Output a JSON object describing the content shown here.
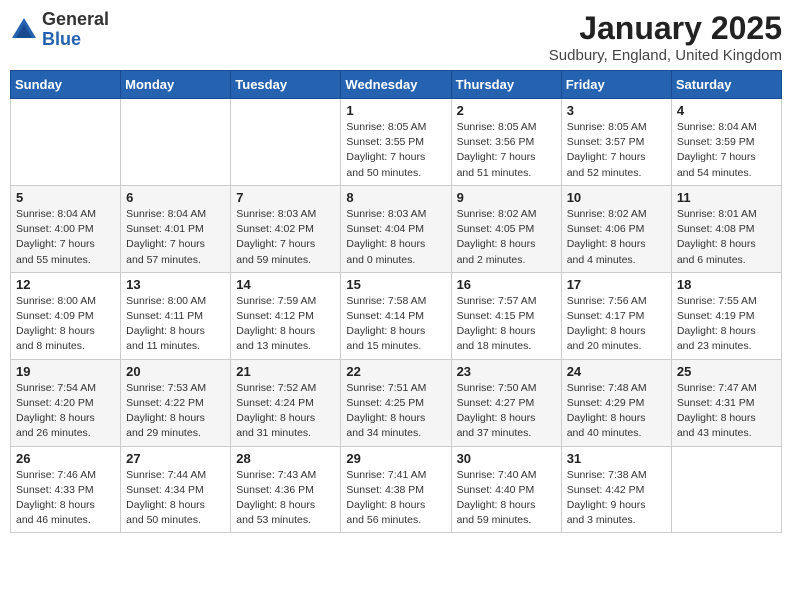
{
  "header": {
    "logo_general": "General",
    "logo_blue": "Blue",
    "month_title": "January 2025",
    "subtitle": "Sudbury, England, United Kingdom"
  },
  "days_of_week": [
    "Sunday",
    "Monday",
    "Tuesday",
    "Wednesday",
    "Thursday",
    "Friday",
    "Saturday"
  ],
  "weeks": [
    [
      {
        "day": "",
        "info": ""
      },
      {
        "day": "",
        "info": ""
      },
      {
        "day": "",
        "info": ""
      },
      {
        "day": "1",
        "info": "Sunrise: 8:05 AM\nSunset: 3:55 PM\nDaylight: 7 hours\nand 50 minutes."
      },
      {
        "day": "2",
        "info": "Sunrise: 8:05 AM\nSunset: 3:56 PM\nDaylight: 7 hours\nand 51 minutes."
      },
      {
        "day": "3",
        "info": "Sunrise: 8:05 AM\nSunset: 3:57 PM\nDaylight: 7 hours\nand 52 minutes."
      },
      {
        "day": "4",
        "info": "Sunrise: 8:04 AM\nSunset: 3:59 PM\nDaylight: 7 hours\nand 54 minutes."
      }
    ],
    [
      {
        "day": "5",
        "info": "Sunrise: 8:04 AM\nSunset: 4:00 PM\nDaylight: 7 hours\nand 55 minutes."
      },
      {
        "day": "6",
        "info": "Sunrise: 8:04 AM\nSunset: 4:01 PM\nDaylight: 7 hours\nand 57 minutes."
      },
      {
        "day": "7",
        "info": "Sunrise: 8:03 AM\nSunset: 4:02 PM\nDaylight: 7 hours\nand 59 minutes."
      },
      {
        "day": "8",
        "info": "Sunrise: 8:03 AM\nSunset: 4:04 PM\nDaylight: 8 hours\nand 0 minutes."
      },
      {
        "day": "9",
        "info": "Sunrise: 8:02 AM\nSunset: 4:05 PM\nDaylight: 8 hours\nand 2 minutes."
      },
      {
        "day": "10",
        "info": "Sunrise: 8:02 AM\nSunset: 4:06 PM\nDaylight: 8 hours\nand 4 minutes."
      },
      {
        "day": "11",
        "info": "Sunrise: 8:01 AM\nSunset: 4:08 PM\nDaylight: 8 hours\nand 6 minutes."
      }
    ],
    [
      {
        "day": "12",
        "info": "Sunrise: 8:00 AM\nSunset: 4:09 PM\nDaylight: 8 hours\nand 8 minutes."
      },
      {
        "day": "13",
        "info": "Sunrise: 8:00 AM\nSunset: 4:11 PM\nDaylight: 8 hours\nand 11 minutes."
      },
      {
        "day": "14",
        "info": "Sunrise: 7:59 AM\nSunset: 4:12 PM\nDaylight: 8 hours\nand 13 minutes."
      },
      {
        "day": "15",
        "info": "Sunrise: 7:58 AM\nSunset: 4:14 PM\nDaylight: 8 hours\nand 15 minutes."
      },
      {
        "day": "16",
        "info": "Sunrise: 7:57 AM\nSunset: 4:15 PM\nDaylight: 8 hours\nand 18 minutes."
      },
      {
        "day": "17",
        "info": "Sunrise: 7:56 AM\nSunset: 4:17 PM\nDaylight: 8 hours\nand 20 minutes."
      },
      {
        "day": "18",
        "info": "Sunrise: 7:55 AM\nSunset: 4:19 PM\nDaylight: 8 hours\nand 23 minutes."
      }
    ],
    [
      {
        "day": "19",
        "info": "Sunrise: 7:54 AM\nSunset: 4:20 PM\nDaylight: 8 hours\nand 26 minutes."
      },
      {
        "day": "20",
        "info": "Sunrise: 7:53 AM\nSunset: 4:22 PM\nDaylight: 8 hours\nand 29 minutes."
      },
      {
        "day": "21",
        "info": "Sunrise: 7:52 AM\nSunset: 4:24 PM\nDaylight: 8 hours\nand 31 minutes."
      },
      {
        "day": "22",
        "info": "Sunrise: 7:51 AM\nSunset: 4:25 PM\nDaylight: 8 hours\nand 34 minutes."
      },
      {
        "day": "23",
        "info": "Sunrise: 7:50 AM\nSunset: 4:27 PM\nDaylight: 8 hours\nand 37 minutes."
      },
      {
        "day": "24",
        "info": "Sunrise: 7:48 AM\nSunset: 4:29 PM\nDaylight: 8 hours\nand 40 minutes."
      },
      {
        "day": "25",
        "info": "Sunrise: 7:47 AM\nSunset: 4:31 PM\nDaylight: 8 hours\nand 43 minutes."
      }
    ],
    [
      {
        "day": "26",
        "info": "Sunrise: 7:46 AM\nSunset: 4:33 PM\nDaylight: 8 hours\nand 46 minutes."
      },
      {
        "day": "27",
        "info": "Sunrise: 7:44 AM\nSunset: 4:34 PM\nDaylight: 8 hours\nand 50 minutes."
      },
      {
        "day": "28",
        "info": "Sunrise: 7:43 AM\nSunset: 4:36 PM\nDaylight: 8 hours\nand 53 minutes."
      },
      {
        "day": "29",
        "info": "Sunrise: 7:41 AM\nSunset: 4:38 PM\nDaylight: 8 hours\nand 56 minutes."
      },
      {
        "day": "30",
        "info": "Sunrise: 7:40 AM\nSunset: 4:40 PM\nDaylight: 8 hours\nand 59 minutes."
      },
      {
        "day": "31",
        "info": "Sunrise: 7:38 AM\nSunset: 4:42 PM\nDaylight: 9 hours\nand 3 minutes."
      },
      {
        "day": "",
        "info": ""
      }
    ]
  ]
}
